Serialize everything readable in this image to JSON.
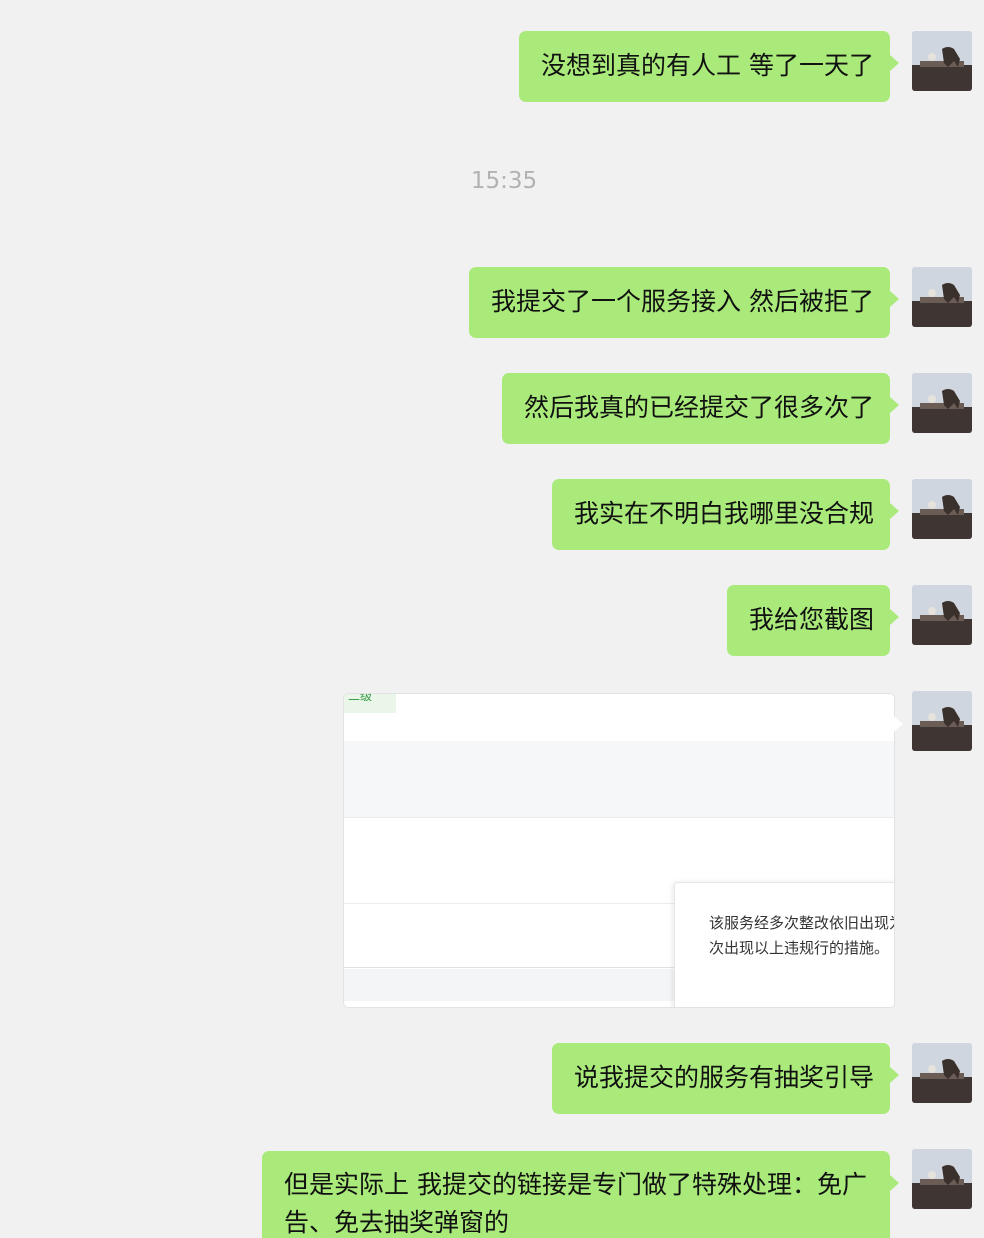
{
  "messages": [
    {
      "text": "没想到真的有人工 等了一天了"
    },
    {
      "text": "我提交了一个服务接入 然后被拒了"
    },
    {
      "text": "然后我真的已经提交了很多次了"
    },
    {
      "text": "我实在不明白我哪里没合规"
    },
    {
      "text": "我给您截图"
    },
    {
      "text": "说我提交的服务有抽奖引导"
    },
    {
      "text": "但是实际上 我提交的链接是专门做了特殊处理：免广告、免去抽奖弹窗的"
    }
  ],
  "timestamp": "15:35",
  "screenshot": {
    "corner_text": "二级",
    "popup_text": "该服务经多次整改依旧出现为，若再次出现以上违规行的措施。"
  },
  "colors": {
    "background": "#f1f1f1",
    "bubble": "#a9ea7a",
    "timestamp": "#b2b2b2"
  },
  "icons": {
    "avatar": "user-avatar-photo"
  }
}
